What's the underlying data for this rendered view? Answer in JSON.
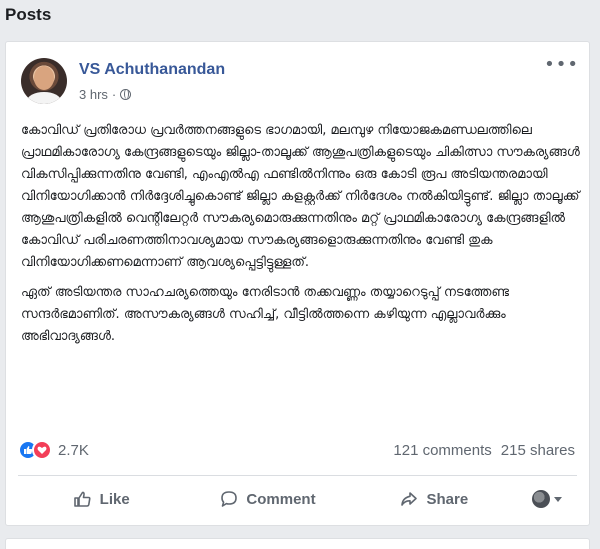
{
  "section": {
    "title": "Posts"
  },
  "post": {
    "author": "VS Achuthanandan",
    "time": "3 hrs",
    "separator": "·",
    "more_icon": "more-horizontal-icon",
    "paragraphs": [
      "കോവിഡ് പ്രതിരോധ പ്രവർത്തനങ്ങളുടെ ഭാഗമായി, മലമ്പുഴ നിയോജകമണ്ഡലത്തിലെ പ്രാഥമികാരോഗ്യ കേന്ദ്രങ്ങളുടെയും ജില്ലാ-താലൂക്ക് ആശുപത്രികളുടെയും ചികിത്സാ സൗകര്യങ്ങൾ വികസിപ്പിക്കുന്നതിനു വേണ്ടി, എംഎൽഎ ഫണ്ടിൽനിന്നും ഒരു കോടി രൂപ അടിയന്തരമായി വിനിയോഗിക്കാൻ നിർദ്ദേശിച്ചുകൊണ്ട് ജില്ലാ കളക്റ്റർക്ക് നിർദേശം നൽകിയിട്ടുണ്ട്. ജില്ലാ താലൂക്ക് ആശുപത്രികളിൽ വെന്റിലേറ്റർ സൗകര്യമൊരുക്കുന്നതിനും മറ്റ് പ്രാഥമികാരോഗ്യ കേന്ദ്രങ്ങളിൽ കോവിഡ് പരിചരണത്തിനാവശ്യമായ സൗകര്യങ്ങളൊരുക്കുന്നതിനും വേണ്ടി തുക വിനിയോഗിക്കണമെന്നാണ് ആവശ്യപ്പെട്ടിട്ടുള്ളത്.",
      "ഏത് അടിയന്തര സാഹചര്യത്തെയും നേരിടാൻ തക്കവണ്ണം തയ്യാറെടുപ്പ് നടത്തേണ്ട സന്ദർഭമാണിത്. അസൗകര്യങ്ങൾ സഹിച്ച്, വീട്ടിൽത്തന്നെ കഴിയുന്ന എല്ലാവർക്കും അഭിവാദ്യങ്ങൾ."
    ],
    "reactions": {
      "count": "2.7K",
      "icons": [
        "like-icon",
        "love-icon"
      ]
    },
    "comments": "121 comments",
    "shares": "215 shares",
    "actions": {
      "like": "Like",
      "comment": "Comment",
      "share": "Share"
    }
  },
  "colors": {
    "author_link": "#385898",
    "like_blue": "#1877f2",
    "love_red": "#f33e58",
    "secondary_text": "#606770"
  }
}
